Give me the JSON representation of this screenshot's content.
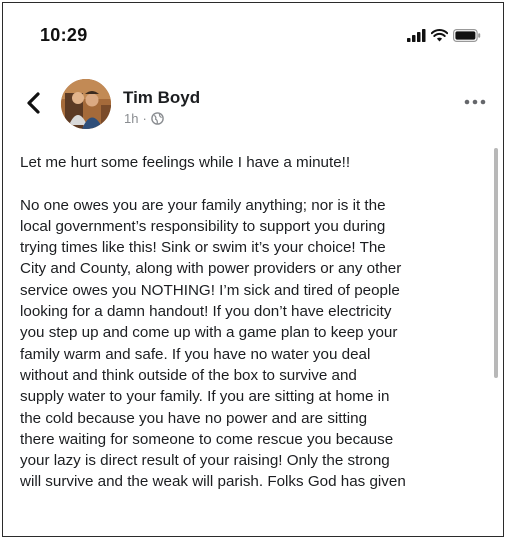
{
  "status_bar": {
    "time": "10:29"
  },
  "post": {
    "author": "Tim Boyd",
    "time_ago": "1h",
    "separator": "·",
    "paragraphs": [
      "Let me hurt some feelings while I have a minute!!",
      "No one owes you are your family anything; nor is it the\nlocal government’s responsibility to support you during\ntrying times like this! Sink or swim it’s your choice!  The\nCity and County, along with power providers or any other\nservice owes you NOTHING!  I’m sick and tired of people\nlooking for a damn handout!  If you don’t have electricity\nyou step up and come up with a game plan to keep your\nfamily warm and safe. If you have no water you deal\nwithout and think outside of the box to survive and\nsupply water to your family. If you are sitting at home in\nthe cold because you have no power and are sitting\nthere waiting for someone to come rescue you because\nyour lazy is direct result of your raising!  Only the strong\nwill survive and the weak will parish. Folks God has given"
    ]
  },
  "icons": {
    "signal": "cellular-signal-icon",
    "wifi": "wifi-icon",
    "battery": "battery-icon",
    "back": "chevron-left-icon",
    "audience": "globe-icon",
    "more": "more-options-icon"
  },
  "colors": {
    "text": "#1c1e21",
    "meta": "#8a8d91",
    "background": "#ffffff"
  }
}
